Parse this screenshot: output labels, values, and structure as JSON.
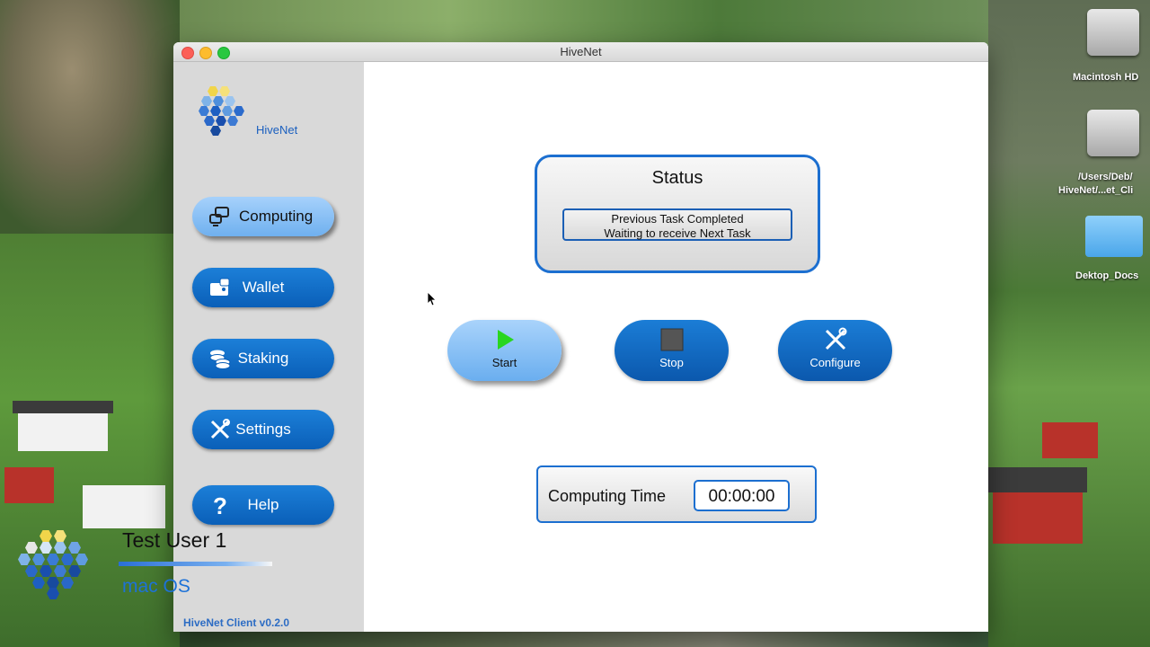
{
  "window": {
    "title": "HiveNet"
  },
  "sidebar": {
    "logo_text": "HiveNet",
    "items": [
      {
        "label": "Computing",
        "icon": "computing-icon",
        "active": true
      },
      {
        "label": "Wallet",
        "icon": "wallet-icon",
        "active": false
      },
      {
        "label": "Staking",
        "icon": "coins-icon",
        "active": false
      },
      {
        "label": "Settings",
        "icon": "tools-icon",
        "active": false
      },
      {
        "label": "Help",
        "icon": "question-icon",
        "active": false
      }
    ],
    "version": "HiveNet Client v0.2.0"
  },
  "status": {
    "title": "Status",
    "line1": "Previous Task Completed",
    "line2": "Waiting to receive Next Task"
  },
  "actions": {
    "start": "Start",
    "stop": "Stop",
    "configure": "Configure"
  },
  "computing_time": {
    "label": "Computing Time",
    "value": "00:00:00"
  },
  "desktop": {
    "icons": [
      {
        "label": "Macintosh HD",
        "icon": "hard-drive-icon"
      },
      {
        "label_line1": "/Users/Deb/",
        "label_line2": "HiveNet/...et_Cli",
        "icon": "disk-image-icon"
      },
      {
        "label": "Dektop_Docs",
        "icon": "folder-icon"
      }
    ]
  },
  "overlay": {
    "user": "Test User 1",
    "os": "mac OS"
  },
  "colors": {
    "accent": "#0b5fb8",
    "active_button": "#8cc3f6",
    "sidebar": "#d9d9d9",
    "brand_text": "#1a5fbf"
  }
}
